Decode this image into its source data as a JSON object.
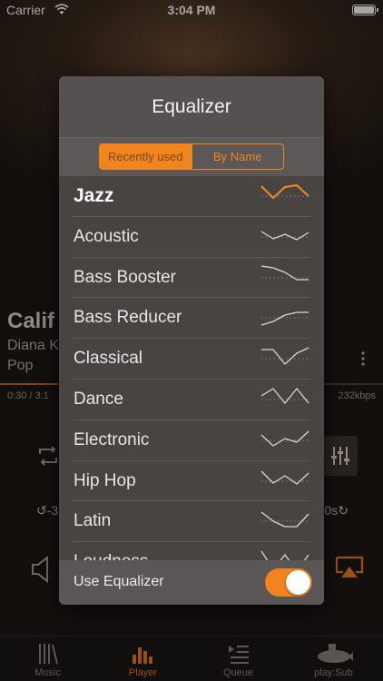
{
  "status_bar": {
    "carrier": "Carrier",
    "time": "3:04 PM"
  },
  "background_player": {
    "title": "Calif",
    "artist": "Diana K",
    "genre": "Pop",
    "time": "0:30 / 3:1",
    "bitrate": "232kbps",
    "skip_back_label": "↺-3",
    "skip_forward_label": "0s↻"
  },
  "tab_bar": {
    "items": [
      {
        "label": "Music",
        "icon": "library-icon"
      },
      {
        "label": "Player",
        "icon": "equalizer-bars-icon"
      },
      {
        "label": "Queue",
        "icon": "queue-list-icon"
      },
      {
        "label": "play:Sub",
        "icon": "submarine-icon"
      }
    ],
    "active": "Player"
  },
  "equalizer_modal": {
    "title": "Equalizer",
    "segments": [
      "Recently used",
      "By Name"
    ],
    "selected_segment": "Recently used",
    "presets": [
      {
        "name": "Jazz",
        "selected": true,
        "curve": [
          5,
          18,
          6,
          4,
          16
        ]
      },
      {
        "name": "Acoustic",
        "curve": [
          10,
          18,
          13,
          19,
          11
        ]
      },
      {
        "name": "Bass Booster",
        "curve": [
          3,
          5,
          10,
          18,
          18
        ]
      },
      {
        "name": "Bass Reducer",
        "curve": [
          24,
          20,
          13,
          10,
          10
        ]
      },
      {
        "name": "Classical",
        "curve": [
          6,
          6,
          22,
          10,
          4
        ]
      },
      {
        "name": "Dance",
        "curve": [
          12,
          4,
          20,
          4,
          20
        ]
      },
      {
        "name": "Electronic",
        "curve": [
          10,
          22,
          14,
          18,
          6
        ]
      },
      {
        "name": "Hip Hop",
        "curve": [
          5,
          18,
          10,
          19,
          7
        ]
      },
      {
        "name": "Latin",
        "curve": [
          6,
          16,
          22,
          22,
          8
        ]
      },
      {
        "name": "Loudness",
        "curve": [
          4,
          24,
          8,
          26,
          8
        ]
      }
    ],
    "footer_label": "Use Equalizer",
    "use_equalizer": true
  },
  "colors": {
    "accent": "#f0851e",
    "modal_bg": "#484442",
    "curve_stroke": "#d9d6d4"
  }
}
